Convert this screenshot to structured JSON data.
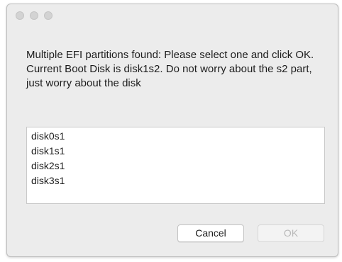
{
  "dialog": {
    "message": "Multiple EFI partitions found: Please select one and click OK. Current Boot Disk is disk1s2. Do not worry about the s2 part, just worry about the disk",
    "list_items": [
      "disk0s1",
      "disk1s1",
      "disk2s1",
      "disk3s1"
    ],
    "cancel_label": "Cancel",
    "ok_label": "OK",
    "ok_enabled": false
  },
  "colors": {
    "window_background": "#ececec",
    "traffic_light_inactive": "#d3d3d3",
    "disabled_text": "#b9b9b9"
  }
}
